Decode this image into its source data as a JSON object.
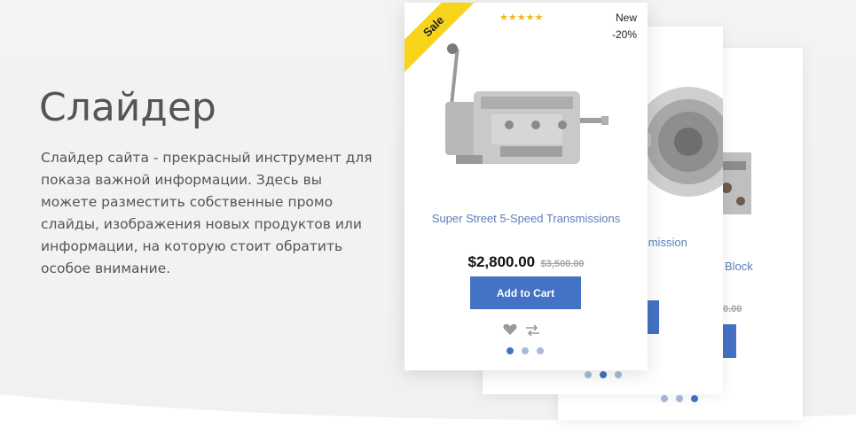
{
  "section": {
    "heading": "Слайдер",
    "description": "Слайдер сайта - прекрасный инструмент для показа важной информации. Здесь вы можете разместить собственные промо слайды, изображения новых продуктов или информации, на которую стоит обратить особое внимание."
  },
  "front_card": {
    "ribbon": "Sale",
    "rating_stars": "★★★★★",
    "badge_new": "New",
    "badge_discount": "-20%",
    "title": "Super Street 5-Speed Transmissions",
    "price": "$2,800.00",
    "old_price": "$3,500.00",
    "cart_label": "Add to Cart",
    "wishlist_icon": "heart-icon",
    "compare_icon": "compare-arrows-icon"
  },
  "back_card_1": {
    "title_partial": "nsmission"
  },
  "back_card_2": {
    "title_partial": "Block",
    "old_price_partial": "0.00"
  },
  "colors": {
    "accent": "#4472c4",
    "ribbon": "#f8d41a",
    "link": "#5a7fb8",
    "stars": "#f3b51c"
  }
}
